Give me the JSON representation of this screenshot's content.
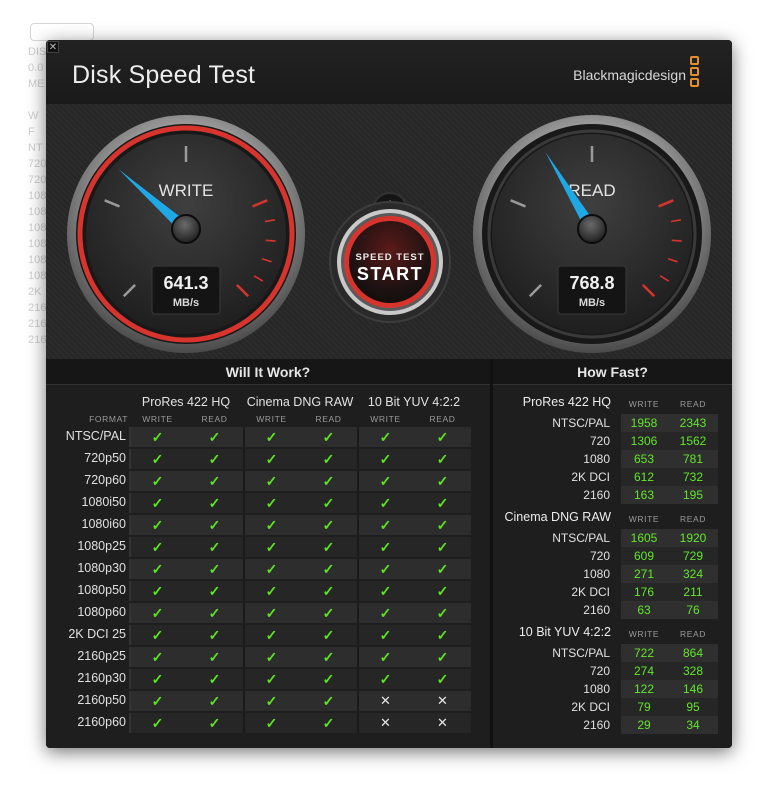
{
  "window": {
    "title": "Disk Speed Test",
    "brand": "Blackmagicdesign",
    "close_glyph": "✕"
  },
  "background": {
    "lines": [
      "DIS",
      "0.0",
      "ME",
      "",
      "W",
      "F",
      "NT",
      "720",
      "720",
      "108",
      "108",
      "108",
      "108",
      "108",
      "108",
      "2K",
      "216",
      "216",
      "216"
    ]
  },
  "gauges": {
    "write": {
      "label": "WRITE",
      "value": "641.3",
      "unit": "MB/s",
      "level": 641.3
    },
    "read": {
      "label": "READ",
      "value": "768.8",
      "unit": "MB/s",
      "level": 768.8
    }
  },
  "start_button": {
    "line1": "SPEED TEST",
    "line2": "START"
  },
  "settings": {
    "icon": "gear-icon"
  },
  "will_it_work": {
    "title": "Will It Work?",
    "format_label": "FORMAT",
    "write_label": "WRITE",
    "read_label": "READ",
    "groups": [
      "ProRes 422 HQ",
      "Cinema DNG RAW",
      "10 Bit YUV 4:2:2"
    ],
    "rows": [
      {
        "format": "NTSC/PAL",
        "cells": [
          1,
          1,
          1,
          1,
          1,
          1
        ]
      },
      {
        "format": "720p50",
        "cells": [
          1,
          1,
          1,
          1,
          1,
          1
        ]
      },
      {
        "format": "720p60",
        "cells": [
          1,
          1,
          1,
          1,
          1,
          1
        ]
      },
      {
        "format": "1080i50",
        "cells": [
          1,
          1,
          1,
          1,
          1,
          1
        ]
      },
      {
        "format": "1080i60",
        "cells": [
          1,
          1,
          1,
          1,
          1,
          1
        ]
      },
      {
        "format": "1080p25",
        "cells": [
          1,
          1,
          1,
          1,
          1,
          1
        ]
      },
      {
        "format": "1080p30",
        "cells": [
          1,
          1,
          1,
          1,
          1,
          1
        ]
      },
      {
        "format": "1080p50",
        "cells": [
          1,
          1,
          1,
          1,
          1,
          1
        ]
      },
      {
        "format": "1080p60",
        "cells": [
          1,
          1,
          1,
          1,
          1,
          1
        ]
      },
      {
        "format": "2K DCI 25",
        "cells": [
          1,
          1,
          1,
          1,
          1,
          1
        ]
      },
      {
        "format": "2160p25",
        "cells": [
          1,
          1,
          1,
          1,
          1,
          1
        ]
      },
      {
        "format": "2160p30",
        "cells": [
          1,
          1,
          1,
          1,
          1,
          1
        ]
      },
      {
        "format": "2160p50",
        "cells": [
          1,
          1,
          1,
          1,
          0,
          0
        ]
      },
      {
        "format": "2160p60",
        "cells": [
          1,
          1,
          1,
          1,
          0,
          0
        ]
      }
    ],
    "check_glyph": "✓",
    "cross_glyph": "✕"
  },
  "how_fast": {
    "title": "How Fast?",
    "write_label": "WRITE",
    "read_label": "READ",
    "groups": [
      {
        "name": "ProRes 422 HQ",
        "rows": [
          {
            "label": "NTSC/PAL",
            "write": "1958",
            "read": "2343"
          },
          {
            "label": "720",
            "write": "1306",
            "read": "1562"
          },
          {
            "label": "1080",
            "write": "653",
            "read": "781"
          },
          {
            "label": "2K DCI",
            "write": "612",
            "read": "732"
          },
          {
            "label": "2160",
            "write": "163",
            "read": "195"
          }
        ]
      },
      {
        "name": "Cinema DNG RAW",
        "rows": [
          {
            "label": "NTSC/PAL",
            "write": "1605",
            "read": "1920"
          },
          {
            "label": "720",
            "write": "609",
            "read": "729"
          },
          {
            "label": "1080",
            "write": "271",
            "read": "324"
          },
          {
            "label": "2K DCI",
            "write": "176",
            "read": "211"
          },
          {
            "label": "2160",
            "write": "63",
            "read": "76"
          }
        ]
      },
      {
        "name": "10 Bit YUV 4:2:2",
        "rows": [
          {
            "label": "NTSC/PAL",
            "write": "722",
            "read": "864"
          },
          {
            "label": "720",
            "write": "274",
            "read": "328"
          },
          {
            "label": "1080",
            "write": "122",
            "read": "146"
          },
          {
            "label": "2K DCI",
            "write": "79",
            "read": "95"
          },
          {
            "label": "2160",
            "write": "29",
            "read": "34"
          }
        ]
      }
    ]
  },
  "colors": {
    "accent_red": "#d8342e",
    "needle": "#1fa8e6",
    "ok_green": "#5ce323",
    "brand_orange": "#e0902c"
  }
}
